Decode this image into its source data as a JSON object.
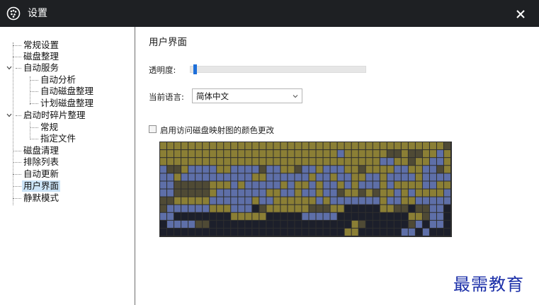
{
  "window": {
    "title": "设置"
  },
  "sidebar": {
    "items": [
      {
        "label": "常规设置"
      },
      {
        "label": "磁盘整理"
      },
      {
        "label": "自动服务",
        "children": [
          {
            "label": "自动分析"
          },
          {
            "label": "自动磁盘整理"
          },
          {
            "label": "计划磁盘整理"
          }
        ]
      },
      {
        "label": "启动时碎片整理",
        "children": [
          {
            "label": "常规"
          },
          {
            "label": "指定文件"
          }
        ]
      },
      {
        "label": "磁盘清理"
      },
      {
        "label": "排除列表"
      },
      {
        "label": "自动更新"
      },
      {
        "label": "用户界面",
        "selected": true
      },
      {
        "label": "静默模式"
      }
    ]
  },
  "main": {
    "title": "用户界面",
    "transparency": {
      "label": "透明度:",
      "value_fraction": 0.02
    },
    "language": {
      "label": "当前语言:",
      "value": "简体中文"
    },
    "color_change": {
      "label": "启用访问磁盘映射图的颜色更改",
      "checked": false
    }
  },
  "disk_map": {
    "colors": {
      "O": "#8b7f35",
      "B": "#5e6fa8",
      "D": "#1c1f2b",
      "K": "#4f4a35"
    },
    "rows": [
      "OOOOOOOOOOOOOOOOOOOOOOOOOOOOOOOOOOOOOOOOK",
      "OOOOOOOOOOOOOOOOOOOOOOOOOBOOOOOOKKOKKOOBO",
      "OOOOOOOOOOOOOOOOOOOOOOOOOOOOOOOBBOOKOOBBO",
      "BKKOBBBBOOBBBBKBBOOKBBOBBBOOKOOOOBBOOBBKO",
      "BBOBBBBBBBBBBOOBBBBBBOBBOBBOOBBOBBBBOBBBB",
      "BBKKKKKOOOBOBBBBBOBOOBOBBOBOBBBOBOOOOBBOO",
      "BBKKKKKOBBBBBBBOOBBOBBOBBKOOKOKOOBOBOOOOB",
      "KKOOOOOBBBBBBOBBOOOOOOBOBBBBBBBOBBOOBBBBB",
      "KBBBBBBOOOBBBDKOOOOOOKKKOODDDDDOOKKDKKBBD",
      "BBDDDDDDDDOOOOODDDDDBBBBBDDDDDDDDDDOOKBBD",
      "DBBBBKKDDDDDDDDDDDDDDDDDDDDOKDDDDDDKBDBBD",
      "DDDDDDDDDDDDDDDDDDDDDDDDDDOODDDDDDBBDBDDD"
    ]
  },
  "watermark": "最需教育"
}
